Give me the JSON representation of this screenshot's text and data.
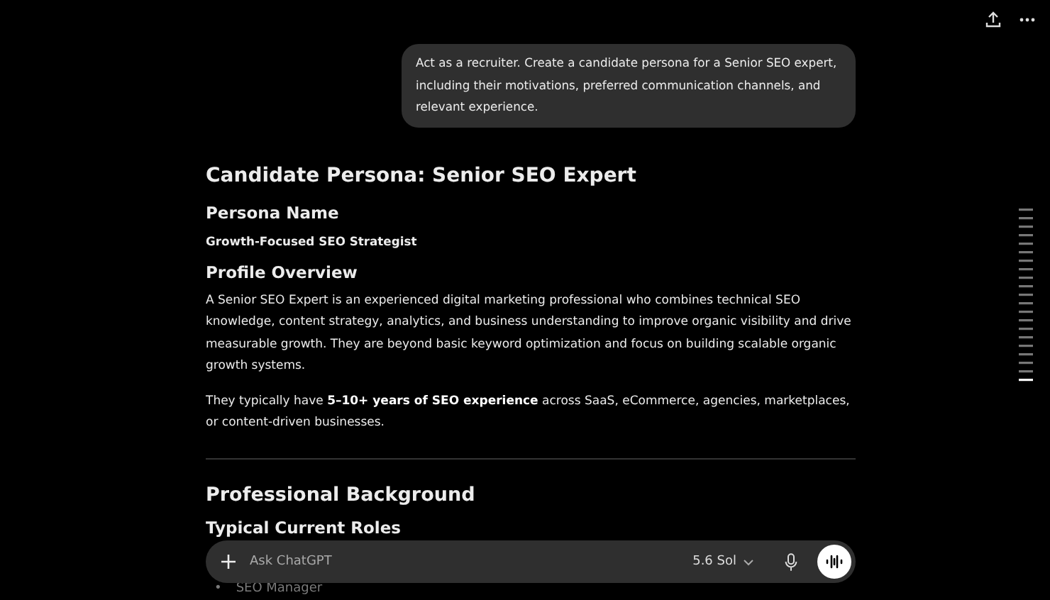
{
  "user_message": "Act as a recruiter. Create a candidate persona for a Senior SEO expert, including their motivations, preferred communication channels, and relevant experience.",
  "response": {
    "title": "Candidate Persona: Senior SEO Expert",
    "sections": [
      {
        "heading": "Persona Name",
        "lead": "Growth-Focused SEO Strategist"
      },
      {
        "heading": "Profile Overview",
        "paragraphs": [
          "A Senior SEO Expert is an experienced digital marketing professional who combines technical SEO knowledge, content strategy, analytics, and business understanding to improve organic visibility and drive measurable growth. They are beyond basic keyword optimization and focus on building scalable organic growth systems.",
          "They typically have **5–10+ years of SEO experience** across SaaS, eCommerce, agencies, marketplaces, or content-driven businesses."
        ]
      }
    ],
    "section_title": "Professional Background",
    "subheading": "Typical Current Roles",
    "list": [
      {
        "marker": "•",
        "text": "SEO Manager"
      }
    ]
  },
  "composer": {
    "placeholder": "Ask ChatGPT",
    "model": "5.6 Sol"
  }
}
